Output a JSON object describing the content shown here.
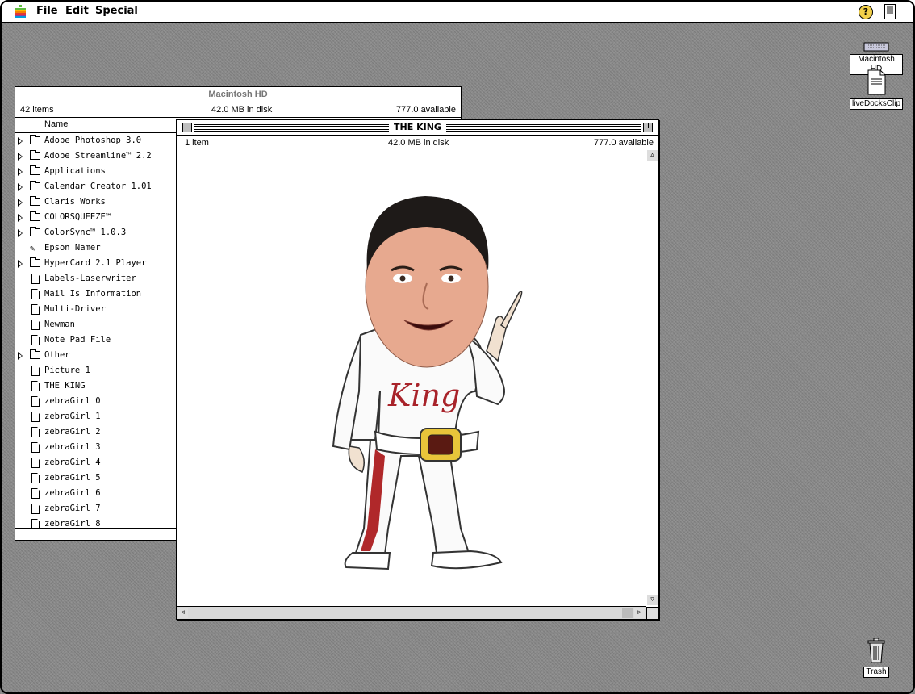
{
  "menubar": {
    "menus": [
      "File",
      "Edit",
      "Special"
    ],
    "help_icon": "help-balloon-icon",
    "app_icon": "finder-application-icon"
  },
  "desktop": {
    "icons": [
      {
        "label": "Macintosh HD",
        "icon": "hard-disk-icon"
      },
      {
        "label": "liveDocksClip",
        "icon": "clipping-document-icon"
      },
      {
        "label": "Trash",
        "icon": "trash-can-icon"
      }
    ]
  },
  "back_window": {
    "title": "Macintosh HD",
    "items_count": "42 items",
    "disk_usage": "42.0 MB in disk",
    "available": "777.0 available",
    "column_name": "Name",
    "items": [
      {
        "label": "Adobe Photoshop 3.0",
        "kind": "folder",
        "expandable": true
      },
      {
        "label": "Adobe Streamline™ 2.2",
        "kind": "folder",
        "expandable": true
      },
      {
        "label": "Applications",
        "kind": "folder",
        "expandable": true
      },
      {
        "label": "Calendar Creator 1.01",
        "kind": "folder",
        "expandable": true
      },
      {
        "label": "Claris Works",
        "kind": "folder",
        "expandable": true
      },
      {
        "label": "COLORSQUEEZE™",
        "kind": "folder",
        "expandable": true
      },
      {
        "label": "ColorSync™ 1.0.3",
        "kind": "folder",
        "expandable": true
      },
      {
        "label": "Epson Namer",
        "kind": "tool",
        "expandable": false
      },
      {
        "label": "HyperCard 2.1 Player",
        "kind": "folder",
        "expandable": true
      },
      {
        "label": "Labels-Laserwriter",
        "kind": "doc",
        "expandable": false
      },
      {
        "label": "Mail Is Information",
        "kind": "doc",
        "expandable": false
      },
      {
        "label": "Multi-Driver",
        "kind": "doc",
        "expandable": false
      },
      {
        "label": "Newman",
        "kind": "doc",
        "expandable": false
      },
      {
        "label": "Note Pad File",
        "kind": "doc",
        "expandable": false
      },
      {
        "label": "Other",
        "kind": "folder",
        "expandable": true
      },
      {
        "label": "Picture 1",
        "kind": "doc",
        "expandable": false
      },
      {
        "label": "THE KING",
        "kind": "doc",
        "expandable": false
      },
      {
        "label": "zebraGirl 0",
        "kind": "doc",
        "expandable": false
      },
      {
        "label": "zebraGirl 1",
        "kind": "doc",
        "expandable": false
      },
      {
        "label": "zebraGirl 2",
        "kind": "doc",
        "expandable": false
      },
      {
        "label": "zebraGirl 3",
        "kind": "doc",
        "expandable": false
      },
      {
        "label": "zebraGirl 4",
        "kind": "doc",
        "expandable": false
      },
      {
        "label": "zebraGirl 5",
        "kind": "doc",
        "expandable": false
      },
      {
        "label": "zebraGirl 6",
        "kind": "doc",
        "expandable": false
      },
      {
        "label": "zebraGirl 7",
        "kind": "doc",
        "expandable": false
      },
      {
        "label": "zebraGirl 8",
        "kind": "doc",
        "expandable": false
      }
    ]
  },
  "front_window": {
    "title": "THE KING",
    "items_count": "1 item",
    "disk_usage": "42.0 MB in disk",
    "available": "777.0 available",
    "image": {
      "description_icon": "king-caricature-image",
      "shirt_text": "King"
    }
  }
}
